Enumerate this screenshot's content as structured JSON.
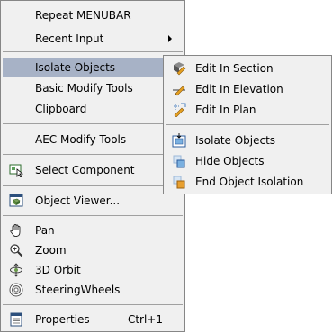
{
  "main_menu": {
    "items": [
      {
        "key": "repeat",
        "label": "Repeat MENUBAR"
      },
      {
        "key": "recent",
        "label": "Recent Input"
      },
      {
        "key": "isolate",
        "label": "Isolate Objects"
      },
      {
        "key": "basic",
        "label": "Basic Modify Tools"
      },
      {
        "key": "clipboard",
        "label": "Clipboard"
      },
      {
        "key": "aec",
        "label": "AEC Modify Tools"
      },
      {
        "key": "select",
        "label": "Select Component"
      },
      {
        "key": "viewer",
        "label": "Object Viewer..."
      },
      {
        "key": "pan",
        "label": "Pan"
      },
      {
        "key": "zoom",
        "label": "Zoom"
      },
      {
        "key": "orbit",
        "label": "3D Orbit"
      },
      {
        "key": "steering",
        "label": "SteeringWheels"
      },
      {
        "key": "properties",
        "label": "Properties",
        "shortcut": "Ctrl+1"
      }
    ]
  },
  "submenu": {
    "items": [
      {
        "key": "edit_section",
        "label": "Edit In Section"
      },
      {
        "key": "edit_elevation",
        "label": "Edit In Elevation"
      },
      {
        "key": "edit_plan",
        "label": "Edit In Plan"
      },
      {
        "key": "isolate_objects",
        "label": "Isolate Objects"
      },
      {
        "key": "hide_objects",
        "label": "Hide Objects"
      },
      {
        "key": "end_isolation",
        "label": "End Object Isolation"
      }
    ]
  },
  "colors": {
    "highlight": "#a7b2c6",
    "menu_bg": "#f0f0f0",
    "border": "#868686"
  }
}
